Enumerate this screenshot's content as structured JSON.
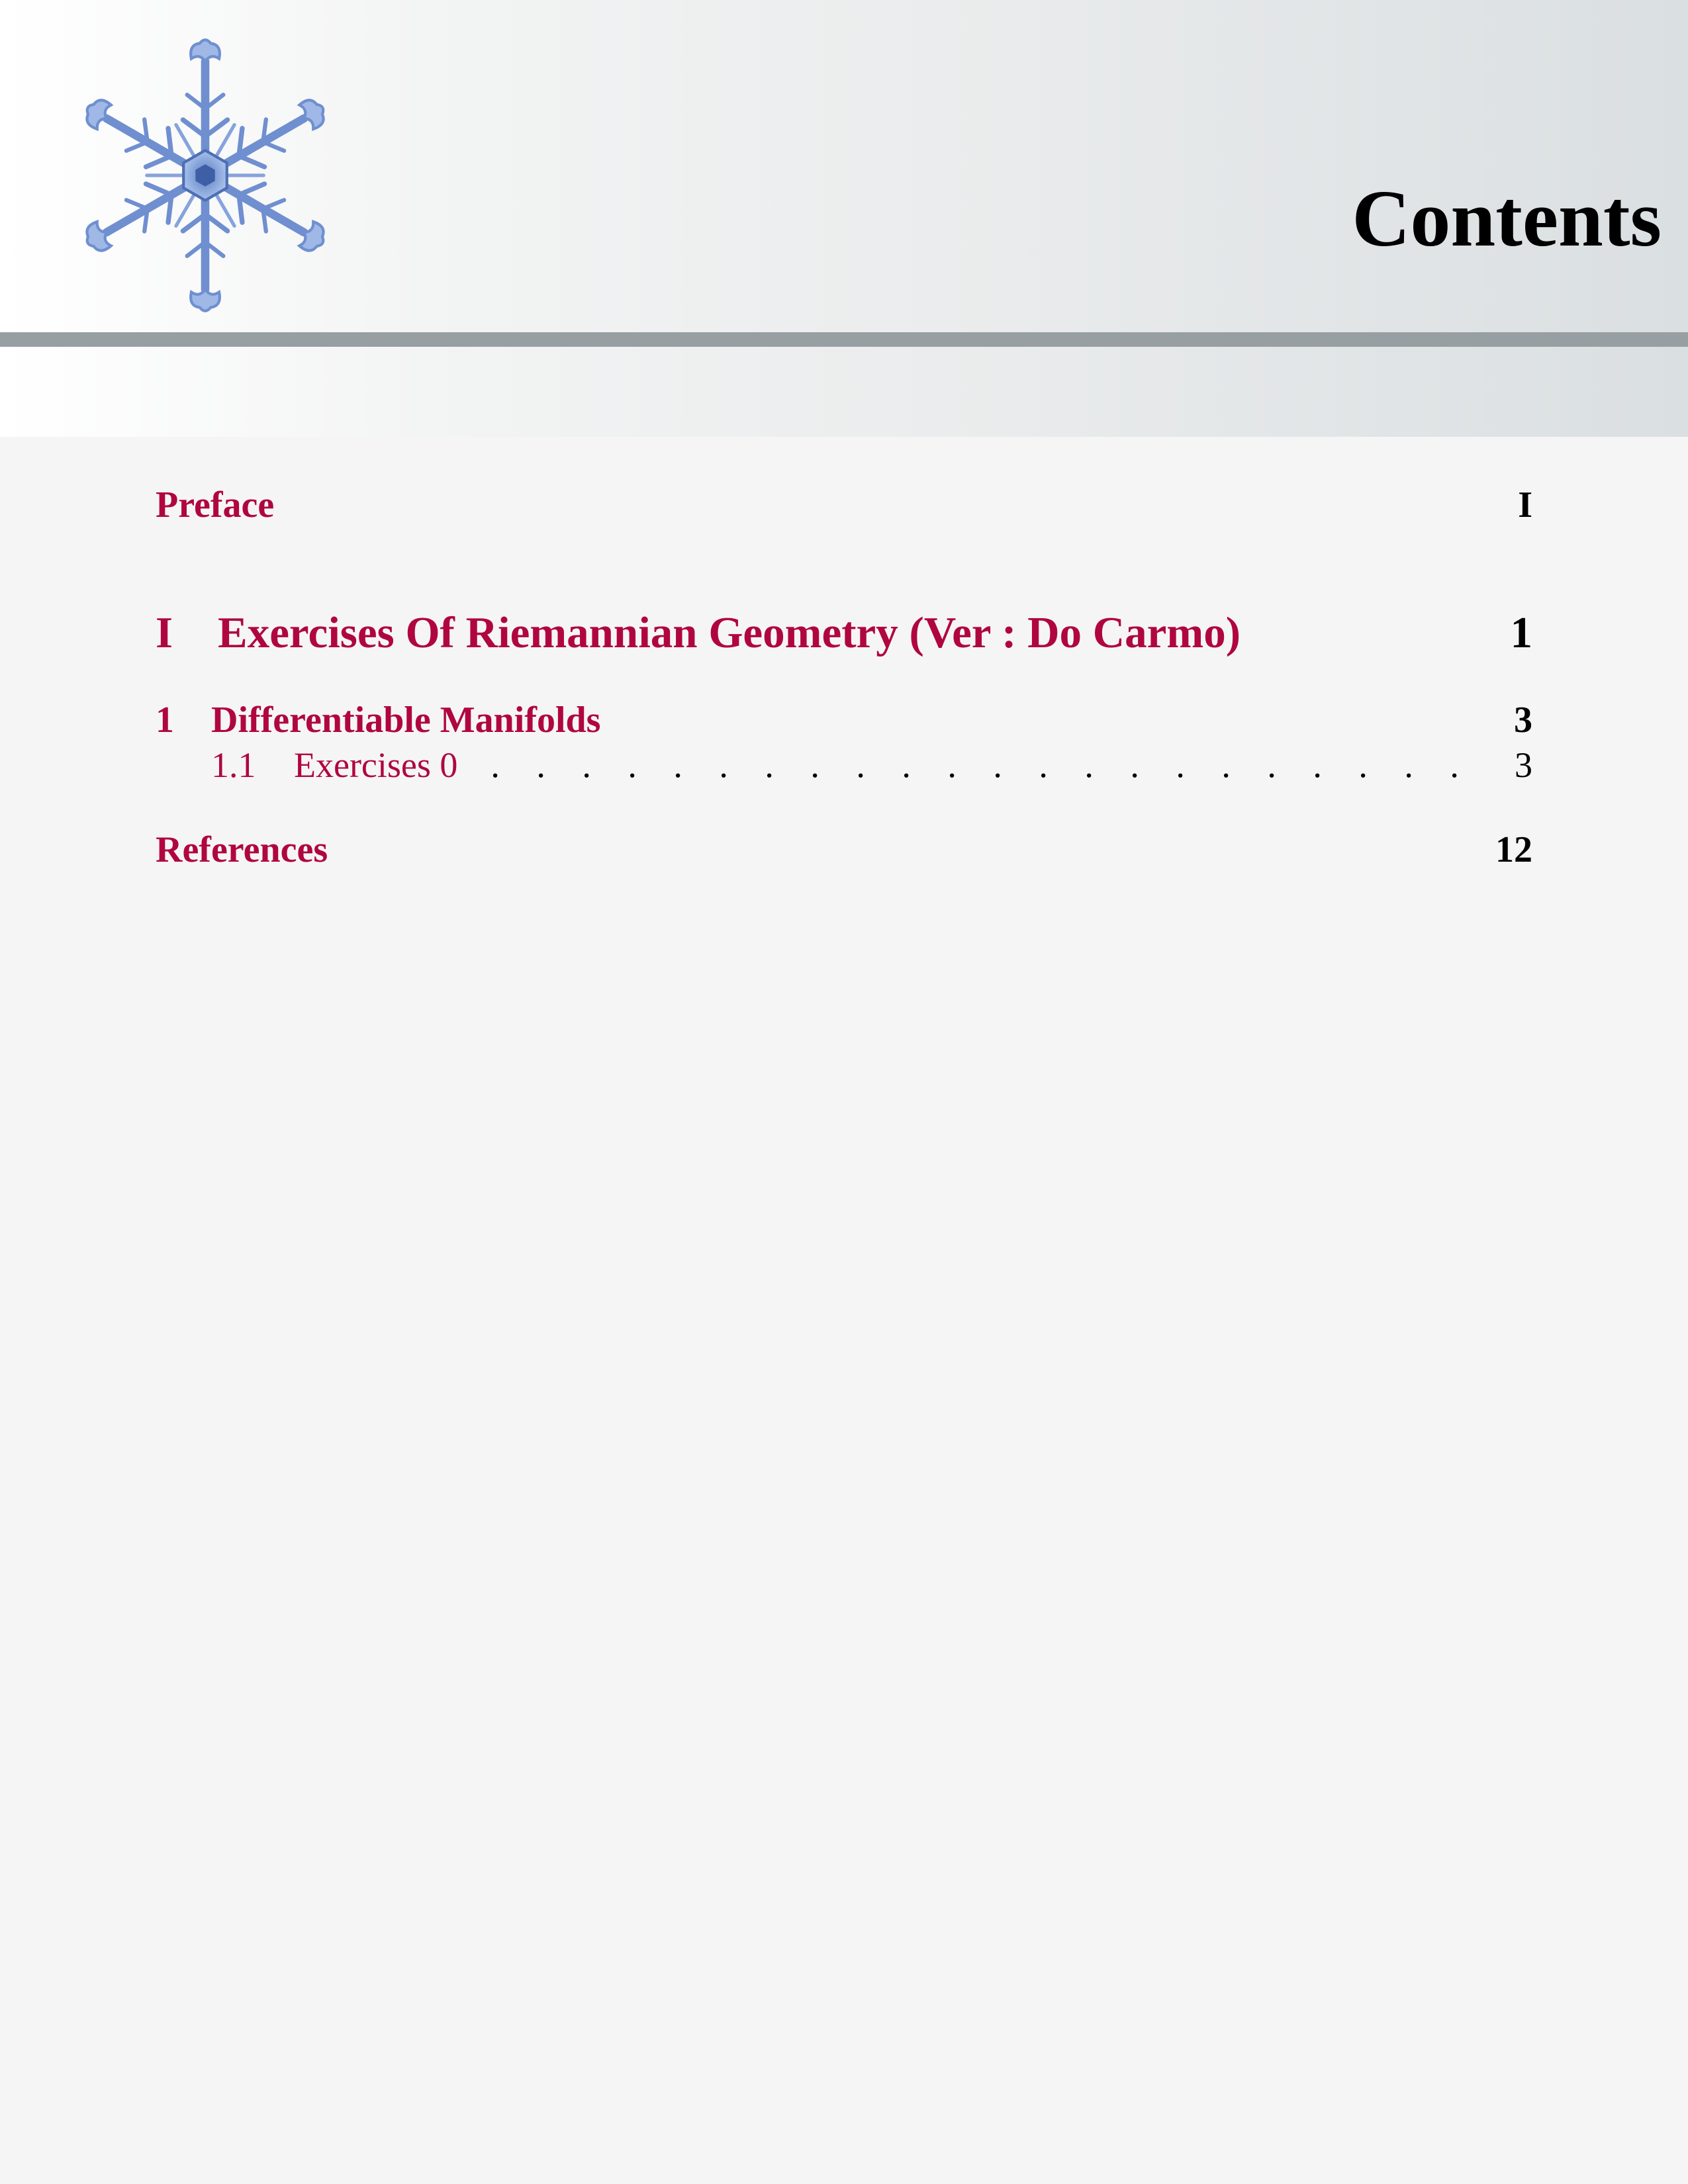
{
  "header": {
    "title": "Contents",
    "ornament": "snowflake-image"
  },
  "toc": {
    "preface": {
      "title": "Preface",
      "page": "I"
    },
    "part": {
      "number": "I",
      "title": "Exercises Of Riemannian Geometry (Ver : Do Carmo)",
      "page": "1"
    },
    "chapter": {
      "number": "1",
      "title": "Differentiable Manifolds",
      "page": "3"
    },
    "section": {
      "number": "1.1",
      "title": "Exercises 0",
      "page": "3",
      "leader": ". . . . . . . . . . . . . . . . . . . . . . . . . . . . . . . . . . . . . . . . . . . . . . . . . . . . . . . . . . . . . . . . . . . . . . . ."
    },
    "references": {
      "title": "References",
      "page": "12"
    }
  },
  "colors": {
    "link": "#b0063f",
    "rule": "#979fa3",
    "page_background": "#f5f5f5"
  }
}
